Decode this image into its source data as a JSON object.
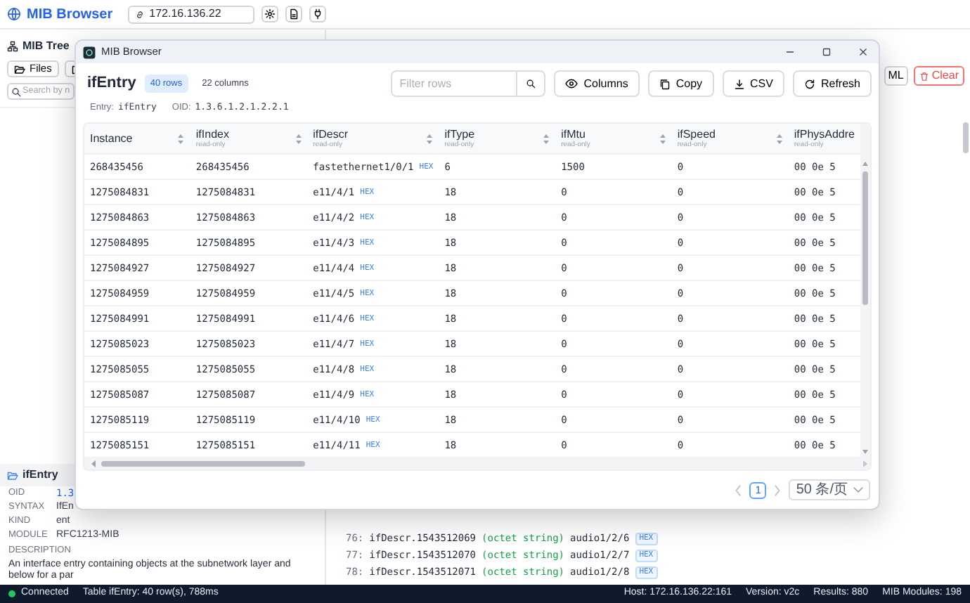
{
  "app": {
    "title": "MIB Browser",
    "address": "172.16.136.22"
  },
  "mib_tree": {
    "title": "MIB Tree",
    "files_button": "Files",
    "search": {
      "placeholder": "Search by n"
    }
  },
  "details": {
    "title": "ifEntry",
    "fields": [
      {
        "label": "OID",
        "value": "1.3",
        "kind": "oid"
      },
      {
        "label": "SYNTAX",
        "value": "IfEn",
        "kind": "text"
      },
      {
        "label": "KIND",
        "value": "ent",
        "kind": "text"
      },
      {
        "label": "MODULE",
        "value": "RFC1213-MIB",
        "kind": "text"
      }
    ],
    "description_label": "DESCRIPTION",
    "description": "An interface entry containing objects at the subnetwork layer and below for a par"
  },
  "results": {
    "buttons": [
      {
        "label": "ML",
        "kind": "default"
      },
      {
        "label": "Clear",
        "kind": "danger"
      }
    ],
    "log": [
      {
        "number": "76:",
        "name": "ifDescr.1543512069",
        "type": "(octet string)",
        "value": "audio1/2/6",
        "badge": "HEX"
      },
      {
        "number": "77:",
        "name": "ifDescr.1543512070",
        "type": "(octet string)",
        "value": "audio1/2/7",
        "badge": "HEX"
      },
      {
        "number": "78:",
        "name": "ifDescr.1543512071",
        "type": "(octet string)",
        "value": "audio1/2/8",
        "badge": "HEX"
      }
    ]
  },
  "dialog": {
    "title": "MIB Browser",
    "heading": "ifEntry",
    "rows_badge": "40 rows",
    "columns_badge": "22 columns",
    "filter": {
      "placeholder": "Filter rows"
    },
    "buttons": [
      "Columns",
      "Copy",
      "CSV",
      "Refresh"
    ],
    "entry_label": "Entry:",
    "entry": "ifEntry",
    "oid_label": "OID:",
    "oid": "1.3.6.1.2.1.2.2.1",
    "table": {
      "columns": [
        {
          "name": "Instance"
        },
        {
          "name": "ifIndex",
          "access": "read-only"
        },
        {
          "name": "ifDescr",
          "access": "read-only"
        },
        {
          "name": "ifType",
          "access": "read-only"
        },
        {
          "name": "ifMtu",
          "access": "read-only"
        },
        {
          "name": "ifSpeed",
          "access": "read-only"
        },
        {
          "name": "ifPhysAddre",
          "access": "read-only"
        }
      ],
      "rows": [
        [
          "268435456",
          "268435456",
          {
            "text": "fastethernet1/0/1",
            "badge": "HEX"
          },
          "6",
          "1500",
          "0",
          "00 0e 5"
        ],
        [
          "1275084831",
          "1275084831",
          {
            "text": "e11/4/1",
            "badge": "HEX"
          },
          "18",
          "0",
          "0",
          "00 0e 5"
        ],
        [
          "1275084863",
          "1275084863",
          {
            "text": "e11/4/2",
            "badge": "HEX"
          },
          "18",
          "0",
          "0",
          "00 0e 5"
        ],
        [
          "1275084895",
          "1275084895",
          {
            "text": "e11/4/3",
            "badge": "HEX"
          },
          "18",
          "0",
          "0",
          "00 0e 5"
        ],
        [
          "1275084927",
          "1275084927",
          {
            "text": "e11/4/4",
            "badge": "HEX"
          },
          "18",
          "0",
          "0",
          "00 0e 5"
        ],
        [
          "1275084959",
          "1275084959",
          {
            "text": "e11/4/5",
            "badge": "HEX"
          },
          "18",
          "0",
          "0",
          "00 0e 5"
        ],
        [
          "1275084991",
          "1275084991",
          {
            "text": "e11/4/6",
            "badge": "HEX"
          },
          "18",
          "0",
          "0",
          "00 0e 5"
        ],
        [
          "1275085023",
          "1275085023",
          {
            "text": "e11/4/7",
            "badge": "HEX"
          },
          "18",
          "0",
          "0",
          "00 0e 5"
        ],
        [
          "1275085055",
          "1275085055",
          {
            "text": "e11/4/8",
            "badge": "HEX"
          },
          "18",
          "0",
          "0",
          "00 0e 5"
        ],
        [
          "1275085087",
          "1275085087",
          {
            "text": "e11/4/9",
            "badge": "HEX"
          },
          "18",
          "0",
          "0",
          "00 0e 5"
        ],
        [
          "1275085119",
          "1275085119",
          {
            "text": "e11/4/10",
            "badge": "HEX"
          },
          "18",
          "0",
          "0",
          "00 0e 5"
        ],
        [
          "1275085151",
          "1275085151",
          {
            "text": "e11/4/11",
            "badge": "HEX"
          },
          "18",
          "0",
          "0",
          "00 0e 5"
        ]
      ]
    },
    "pagination": {
      "pages": [
        {
          "label": "1",
          "selected": true
        }
      ],
      "page_size": "50 条/页"
    }
  },
  "status_bar": {
    "connected": true,
    "connection": "Connected",
    "message": "Table ifEntry: 40 row(s), 788ms",
    "items": [
      "Host: 172.16.136.22:161",
      "Version: v2c",
      "Results: 880",
      "MIB Modules: 198"
    ]
  }
}
